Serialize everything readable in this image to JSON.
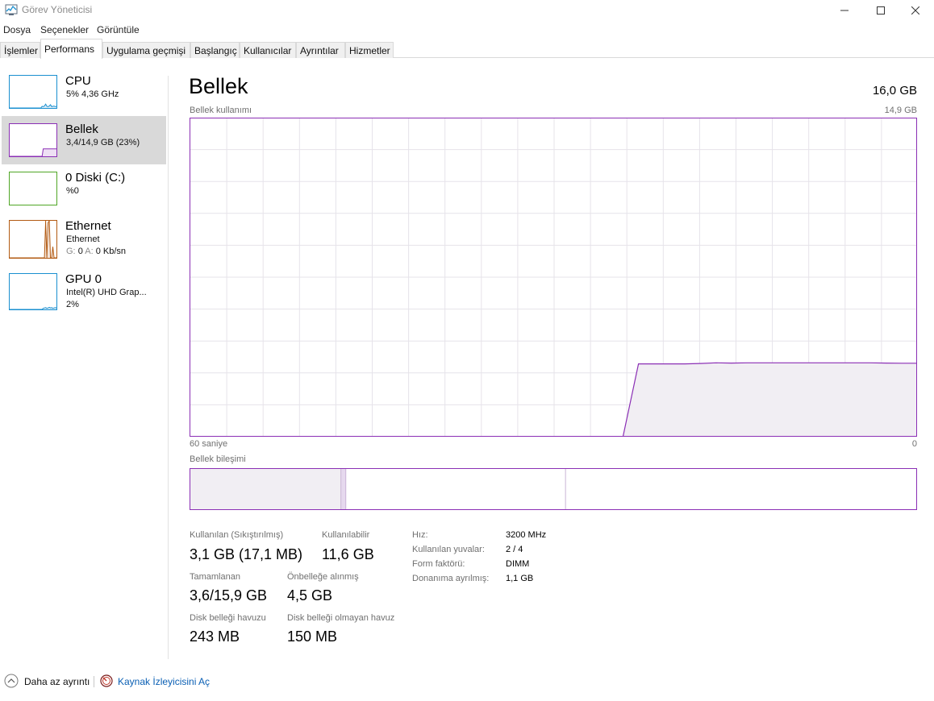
{
  "window": {
    "title": "Görev Yöneticisi",
    "icons": {
      "app": "task-manager-icon",
      "minimize": "minimize-icon",
      "maximize": "maximize-icon",
      "close": "close-icon"
    }
  },
  "menu": [
    "Dosya",
    "Seçenekler",
    "Görüntüle"
  ],
  "tabs": [
    {
      "label": "İşlemler",
      "active": false
    },
    {
      "label": "Performans",
      "active": true
    },
    {
      "label": "Uygulama geçmişi",
      "active": false
    },
    {
      "label": "Başlangıç",
      "active": false
    },
    {
      "label": "Kullanıcılar",
      "active": false
    },
    {
      "label": "Ayrıntılar",
      "active": false
    },
    {
      "label": "Hizmetler",
      "active": false
    }
  ],
  "sidebar": {
    "items": [
      {
        "name": "CPU",
        "line1": "5%  4,36 GHz",
        "color": "#1a8fd0",
        "usage_history_percent": [
          0,
          0,
          0,
          0,
          0,
          0,
          0,
          0,
          0,
          0,
          0,
          0,
          0,
          0,
          0,
          0,
          0,
          0,
          0,
          0,
          0,
          0,
          0,
          0,
          0,
          0,
          0,
          5,
          4,
          6,
          12,
          5,
          4,
          6,
          10,
          4,
          5,
          6,
          4,
          5
        ]
      },
      {
        "name": "Bellek",
        "line1": "3,4/14,9 GB (23%)",
        "color": "#8b2fb5",
        "selected": true,
        "usage_history_percent": [
          0,
          0,
          0,
          0,
          0,
          0,
          0,
          0,
          0,
          0,
          0,
          0,
          0,
          0,
          0,
          0,
          0,
          0,
          0,
          0,
          0,
          0,
          0,
          0,
          0,
          0,
          0,
          0,
          23,
          23,
          23,
          23,
          23,
          23,
          23,
          23,
          23,
          23,
          23,
          23
        ]
      },
      {
        "name": "0 Diski (C:)",
        "line1": "%0",
        "color": "#4fa625",
        "usage_history_percent": []
      },
      {
        "name": "Ethernet",
        "line1": "Ethernet",
        "line2_send_label": "G:",
        "line2_send_value": "0",
        "line2_recv_label": "A:",
        "line2_recv_value": "0 Kb/sn",
        "color": "#b25a12",
        "usage_history_percent": [
          0,
          0,
          0,
          0,
          0,
          0,
          0,
          0,
          0,
          0,
          0,
          0,
          0,
          0,
          0,
          0,
          0,
          0,
          0,
          0,
          0,
          0,
          0,
          0,
          0,
          0,
          0,
          0,
          0,
          0,
          100,
          0,
          95,
          100,
          0,
          0,
          30,
          0,
          0,
          0
        ]
      },
      {
        "name": "GPU 0",
        "line1": "Intel(R) UHD Grap...",
        "line2": "2%",
        "color": "#1a8fd0",
        "usage_history_percent": [
          0,
          0,
          0,
          0,
          0,
          0,
          0,
          0,
          0,
          0,
          0,
          0,
          0,
          0,
          0,
          0,
          0,
          0,
          0,
          0,
          0,
          0,
          0,
          0,
          0,
          0,
          0,
          0,
          3,
          4,
          5,
          3,
          4,
          6,
          4,
          5,
          3,
          4,
          5,
          4
        ]
      }
    ]
  },
  "main": {
    "title": "Bellek",
    "total": "16,0 GB",
    "graph_label": "Bellek kullanımı",
    "graph_max": "14,9 GB",
    "time_left": "60 saniye",
    "time_right": "0",
    "composition_label": "Bellek bileşimi",
    "graph_color": "#8b2fb5",
    "graph_fill": "#f1eef3"
  },
  "chart_data": {
    "type": "area",
    "title": "Bellek kullanımı",
    "x_range_seconds": [
      60,
      0
    ],
    "ylim": [
      0,
      14.9
    ],
    "y_unit": "GB",
    "grid": true,
    "series": [
      {
        "values_gb": [
          0,
          0,
          0,
          0,
          0,
          0,
          0,
          0,
          0,
          0,
          0,
          0,
          0,
          0,
          0,
          0,
          0,
          0,
          0,
          0,
          0,
          0,
          0,
          0,
          0,
          0,
          0,
          0,
          0,
          3.4,
          3.4,
          3.4,
          3.4,
          3.42,
          3.45,
          3.44,
          3.45,
          3.45,
          3.45,
          3.45,
          3.45,
          3.45,
          3.45,
          3.45,
          3.45,
          3.44,
          3.43,
          3.43
        ]
      }
    ],
    "composition_gb": {
      "in_use": 3.1,
      "modified": 0.1,
      "standby": 4.5,
      "free": 7.2,
      "total": 14.9
    }
  },
  "stats": {
    "in_use_label": "Kullanılan (Sıkıştırılmış)",
    "in_use_value": "3,1 GB (17,1 MB)",
    "available_label": "Kullanılabilir",
    "available_value": "11,6 GB",
    "committed_label": "Tamamlanan",
    "committed_value": "3,6/15,9 GB",
    "cached_label": "Önbelleğe alınmış",
    "cached_value": "4,5 GB",
    "paged_label": "Disk belleği havuzu",
    "paged_value": "243 MB",
    "nonpaged_label": "Disk belleği olmayan havuz",
    "nonpaged_value": "150 MB"
  },
  "details": [
    {
      "label": "Hız:",
      "value": "3200 MHz"
    },
    {
      "label": "Kullanılan yuvalar:",
      "value": "2 / 4"
    },
    {
      "label": "Form faktörü:",
      "value": "DIMM"
    },
    {
      "label": "Donanıma ayrılmış:",
      "value": "1,1 GB"
    }
  ],
  "footer": {
    "less_details": "Daha az ayrıntı",
    "resource_monitor": "Kaynak İzleyicisini Aç",
    "icons": {
      "less": "chevron-up-circle-icon",
      "monitor": "resource-monitor-icon"
    }
  }
}
